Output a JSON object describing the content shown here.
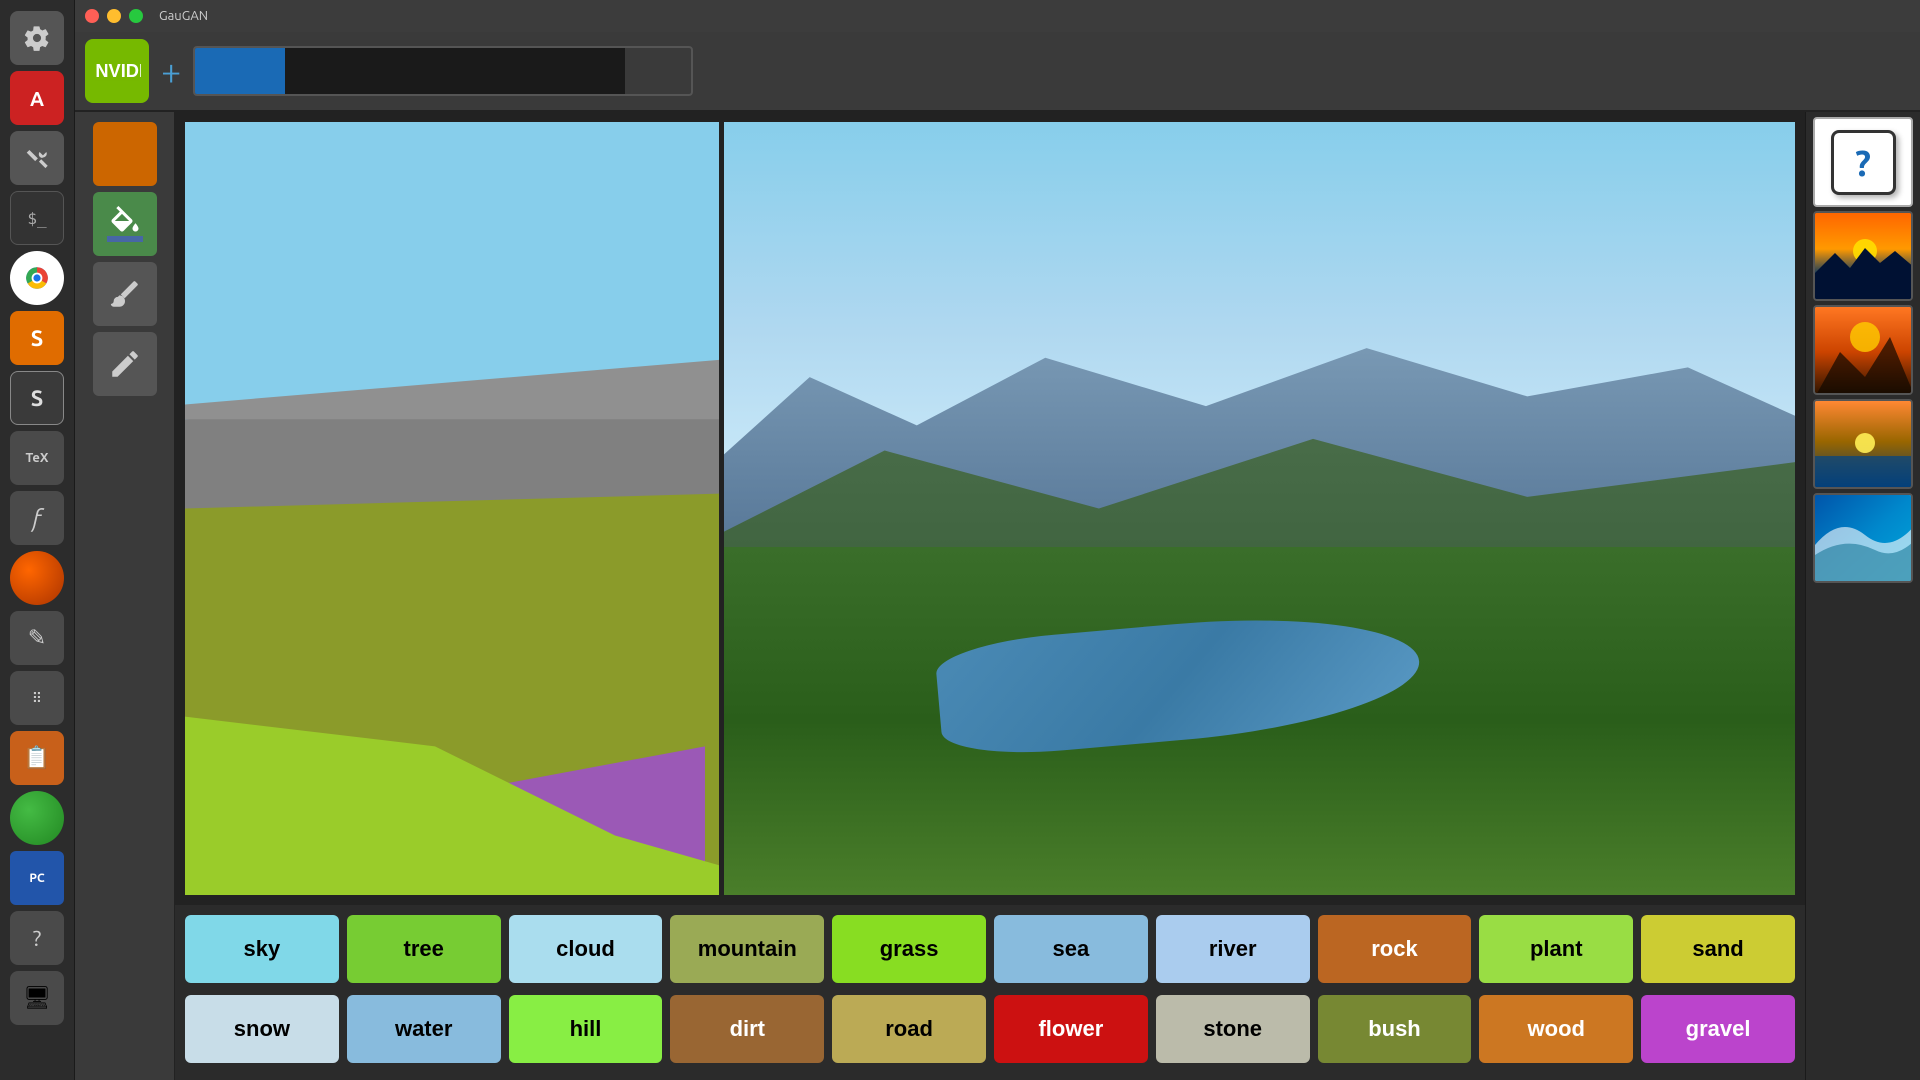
{
  "titlebar": {
    "title": "GauGAN"
  },
  "toolbar": {
    "add_label": "+",
    "bar_tooltip": "Progress bar"
  },
  "tools": [
    {
      "name": "fill-tool",
      "label": "🪣",
      "active": true
    },
    {
      "name": "brush-tool",
      "label": "✏️",
      "active": false
    },
    {
      "name": "pencil-tool",
      "label": "✏",
      "active": false
    }
  ],
  "color_swatch": {
    "label": "Current color",
    "color": "#cc6600"
  },
  "labels_row1": [
    {
      "id": "sky",
      "label": "sky",
      "bg": "#80d8e8",
      "color": "#000"
    },
    {
      "id": "tree",
      "label": "tree",
      "bg": "#77cc33",
      "color": "#000"
    },
    {
      "id": "cloud",
      "label": "cloud",
      "bg": "#aaddee",
      "color": "#000"
    },
    {
      "id": "mountain",
      "label": "mountain",
      "bg": "#9aaa55",
      "color": "#000"
    },
    {
      "id": "grass",
      "label": "grass",
      "bg": "#88dd22",
      "color": "#000"
    },
    {
      "id": "sea",
      "label": "sea",
      "bg": "#88bbdd",
      "color": "#000"
    },
    {
      "id": "river",
      "label": "river",
      "bg": "#aaccee",
      "color": "#000"
    },
    {
      "id": "rock",
      "label": "rock",
      "bg": "#bb6622",
      "color": "#fff"
    },
    {
      "id": "plant",
      "label": "plant",
      "bg": "#99dd44",
      "color": "#000"
    },
    {
      "id": "sand",
      "label": "sand",
      "bg": "#cccc33",
      "color": "#000"
    }
  ],
  "labels_row2": [
    {
      "id": "snow",
      "label": "snow",
      "bg": "#c8dde8",
      "color": "#000"
    },
    {
      "id": "water",
      "label": "water",
      "bg": "#88bbdd",
      "color": "#000"
    },
    {
      "id": "hill",
      "label": "hill",
      "bg": "#88ee44",
      "color": "#000"
    },
    {
      "id": "dirt",
      "label": "dirt",
      "bg": "#996633",
      "color": "#fff"
    },
    {
      "id": "road",
      "label": "road",
      "bg": "#bbaa55",
      "color": "#000"
    },
    {
      "id": "flower",
      "label": "flower",
      "bg": "#cc1111",
      "color": "#fff"
    },
    {
      "id": "stone",
      "label": "stone",
      "bg": "#bbbbaa",
      "color": "#000"
    },
    {
      "id": "bush",
      "label": "bush",
      "bg": "#778833",
      "color": "#fff"
    },
    {
      "id": "wood",
      "label": "wood",
      "bg": "#cc7722",
      "color": "#fff"
    },
    {
      "id": "gravel",
      "label": "gravel",
      "bg": "#bb44cc",
      "color": "#fff"
    }
  ],
  "taskbar_icons": [
    "⚙",
    "A",
    "🔧",
    ">_",
    "🌐",
    "S",
    "S",
    "TeX",
    "f",
    "🌐",
    "✏",
    "···",
    "📋",
    "🌀",
    "💻",
    "?",
    "🖥"
  ]
}
